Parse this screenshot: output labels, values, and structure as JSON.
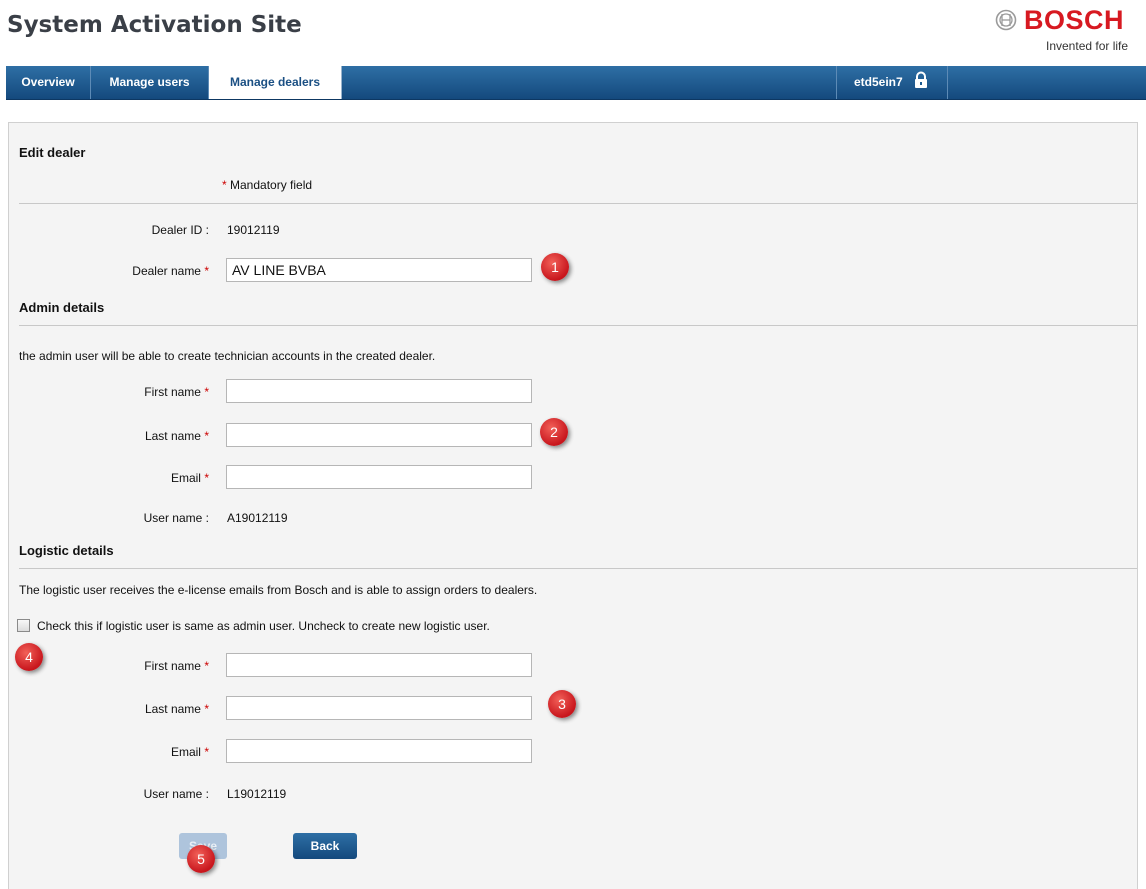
{
  "header": {
    "site_title": "System Activation Site",
    "brand": "BOSCH",
    "tagline": "Invented for life"
  },
  "nav": {
    "tabs": [
      {
        "label": "Overview"
      },
      {
        "label": "Manage users"
      },
      {
        "label": "Manage dealers",
        "active": true
      }
    ],
    "user": "etd5ein7",
    "user_icon": "lock-icon"
  },
  "form": {
    "title": "Edit dealer",
    "mandatory_note": "Mandatory field",
    "required_mark": "*",
    "dealer_id_label": "Dealer ID :",
    "dealer_id_value": "19012119",
    "dealer_name_label": "Dealer name",
    "dealer_name_value": "AV LINE BVBA",
    "admin": {
      "title": "Admin details",
      "description": "the admin user will be able to create technician accounts in the created dealer.",
      "first_name_label": "First name",
      "first_name_value": "",
      "last_name_label": "Last name",
      "last_name_value": "",
      "email_label": "Email",
      "email_value": "",
      "username_label": "User name :",
      "username_value": "A19012119"
    },
    "logistic": {
      "title": "Logistic details",
      "description": "The logistic user receives the e-license emails from Bosch and is able to assign orders to dealers.",
      "same_as_admin_label": "Check this if logistic user is same as admin user. Uncheck to create new logistic user.",
      "same_as_admin_checked": false,
      "first_name_label": "First name",
      "first_name_value": "",
      "last_name_label": "Last name",
      "last_name_value": "",
      "email_label": "Email",
      "email_value": "",
      "username_label": "User name :",
      "username_value": "L19012119"
    },
    "save_label": "Save",
    "back_label": "Back"
  },
  "markers": [
    "1",
    "2",
    "3",
    "4",
    "5"
  ],
  "colors": {
    "brand_red": "#d71921",
    "nav_blue": "#1a5a91",
    "marker_red": "#d62d2d"
  }
}
